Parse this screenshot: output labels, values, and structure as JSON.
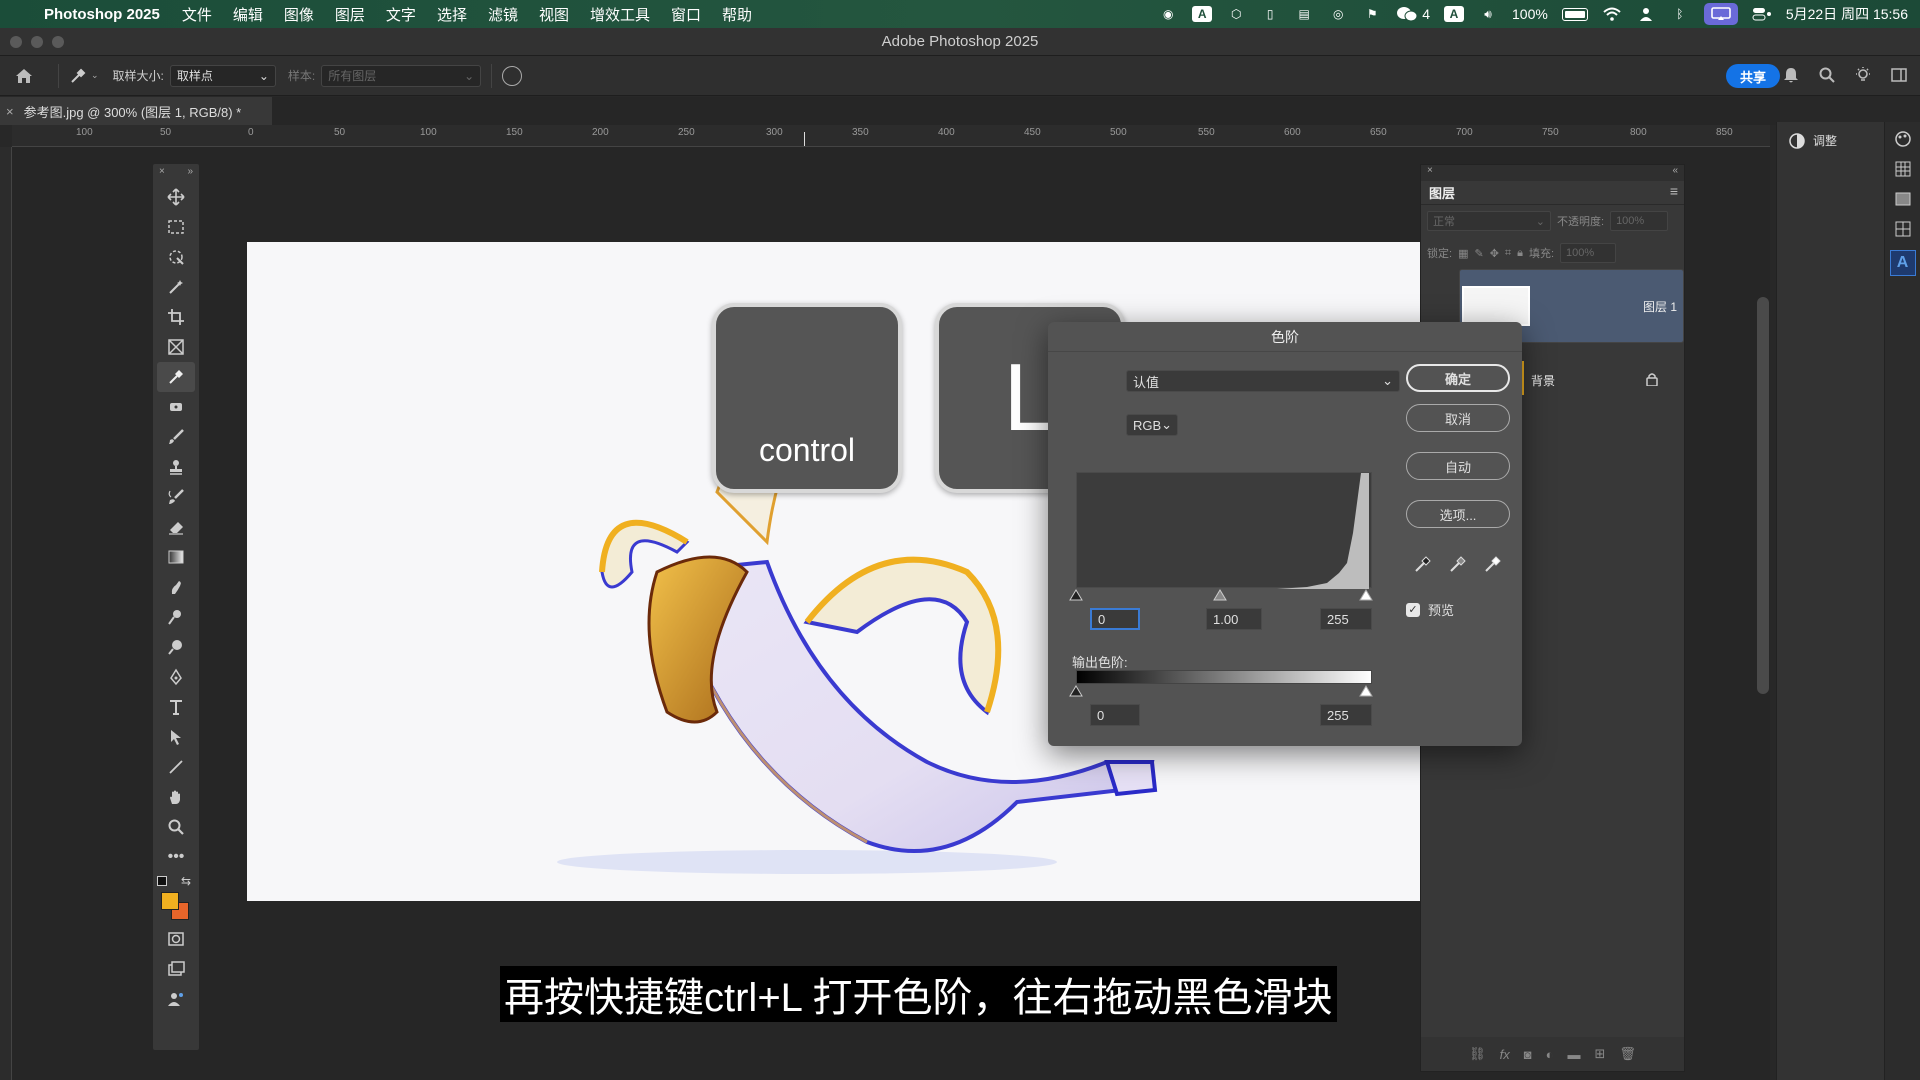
{
  "menubar": {
    "app_name": "Photoshop 2025",
    "items": [
      "文件",
      "编辑",
      "图像",
      "图层",
      "文字",
      "选择",
      "滤镜",
      "视图",
      "增效工具",
      "窗口",
      "帮助"
    ],
    "wechat_count": "4",
    "battery": "100%",
    "datetime": "5月22日 周四  15:56"
  },
  "window": {
    "title": "Adobe Photoshop 2025"
  },
  "options": {
    "sample_size_label": "取样大小:",
    "sample_size_value": "取样点",
    "sample_label": "样本:",
    "sample_value": "所有图层",
    "share": "共享"
  },
  "document": {
    "tab_title": "参考图.jpg @ 300% (图层 1, RGB/8) *"
  },
  "ruler": {
    "ticks": [
      "100",
      "50",
      "0",
      "50",
      "100",
      "150",
      "200",
      "250",
      "300",
      "350",
      "400",
      "450",
      "500",
      "550",
      "600",
      "650",
      "700",
      "750",
      "800",
      "850"
    ]
  },
  "keys": {
    "first": "control",
    "second": "L"
  },
  "levels": {
    "title": "色阶",
    "preset": "认值",
    "channel": "RGB",
    "input_black": "0",
    "input_gamma": "1.00",
    "input_white": "255",
    "output_label": "输出色阶:",
    "output_black": "0",
    "output_white": "255",
    "ok": "确定",
    "cancel": "取消",
    "auto": "自动",
    "options": "选项...",
    "preview": "预览",
    "preview_checked": true
  },
  "layers_panel": {
    "tab": "图层",
    "blend_mode": "正常",
    "opacity_label": "不透明度:",
    "opacity_value": "100%",
    "lock_label": "锁定:",
    "fill_label": "填充:",
    "fill_value": "100%",
    "layers": [
      {
        "name": "图层 1",
        "selected": true
      },
      {
        "name": "背景",
        "locked": true
      }
    ]
  },
  "adjust_panel": {
    "label": "调整"
  },
  "subtitle": "再按快捷键ctrl+L 打开色阶，往右拖动黑色滑块",
  "colors": {
    "foreground": "#f0b020",
    "background": "#e8652a",
    "accent": "#1473e6",
    "selected_layer": "#4b5a72"
  }
}
